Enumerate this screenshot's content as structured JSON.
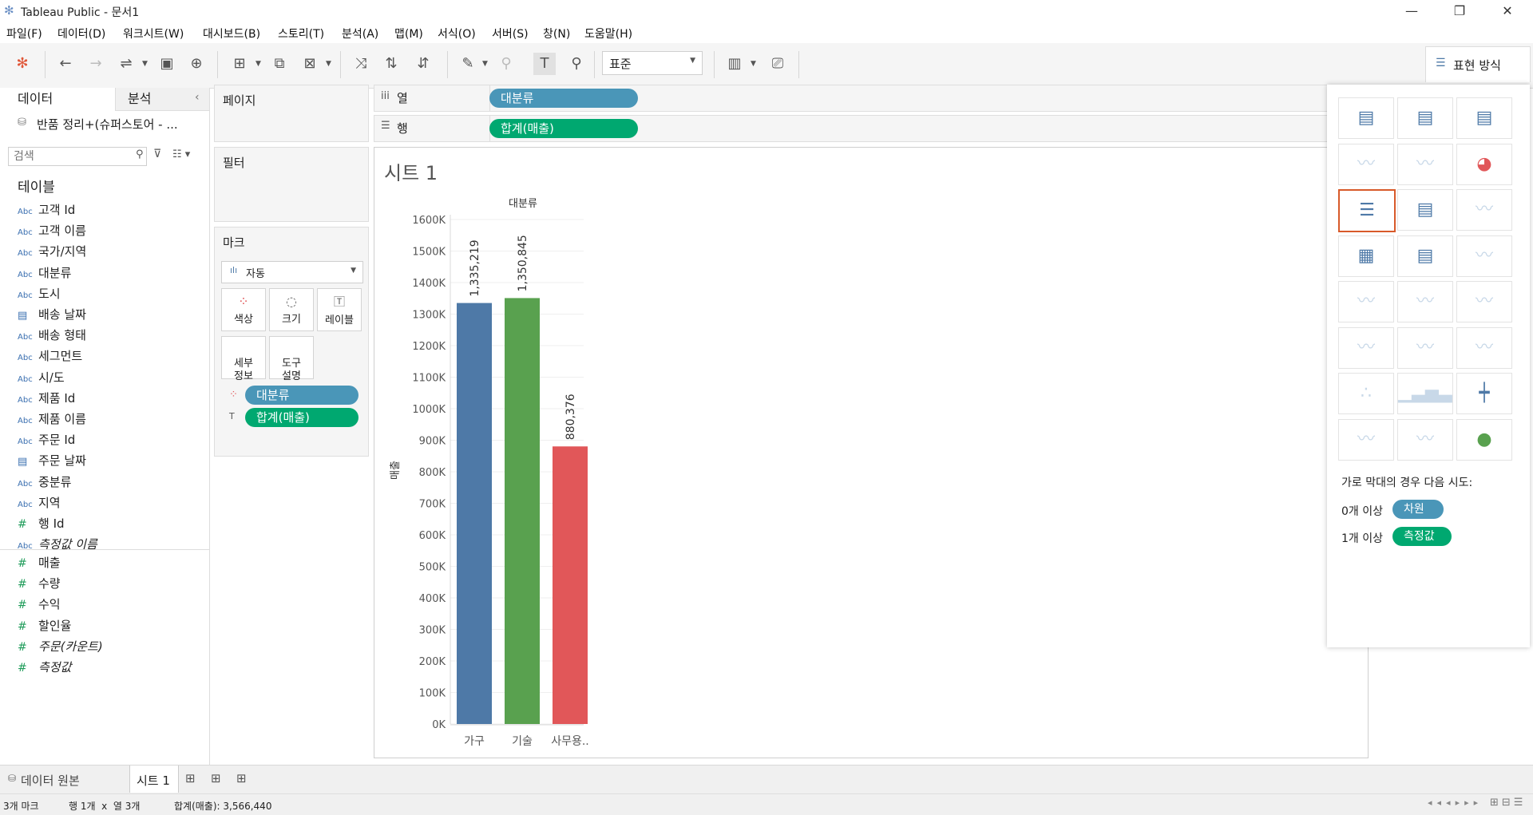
{
  "window": {
    "title": "Tableau Public - 문서1"
  },
  "menu": [
    "파일(F)",
    "데이터(D)",
    "워크시트(W)",
    "대시보드(B)",
    "스토리(T)",
    "분석(A)",
    "맵(M)",
    "서식(O)",
    "서버(S)",
    "창(N)",
    "도움말(H)"
  ],
  "toolbar": {
    "fit_select": "표준",
    "show_me_label": "표현 방식"
  },
  "data_pane": {
    "tab_data": "데이터",
    "tab_analysis": "분석",
    "datasource": "반품 정리+(슈퍼스토어 - ...",
    "search_placeholder": "검색",
    "tables_heading": "테이블",
    "dimensions": [
      {
        "type": "Abc",
        "name": "고객 Id"
      },
      {
        "type": "Abc",
        "name": "고객 이름"
      },
      {
        "type": "Abc",
        "name": "국가/지역"
      },
      {
        "type": "Abc",
        "name": "대분류"
      },
      {
        "type": "Abc",
        "name": "도시"
      },
      {
        "type": "date",
        "name": "배송 날짜"
      },
      {
        "type": "Abc",
        "name": "배송 형태"
      },
      {
        "type": "Abc",
        "name": "세그먼트"
      },
      {
        "type": "Abc",
        "name": "시/도"
      },
      {
        "type": "Abc",
        "name": "제품 Id"
      },
      {
        "type": "Abc",
        "name": "제품 이름"
      },
      {
        "type": "Abc",
        "name": "주문 Id"
      },
      {
        "type": "date",
        "name": "주문 날짜"
      },
      {
        "type": "Abc",
        "name": "중분류"
      },
      {
        "type": "Abc",
        "name": "지역"
      },
      {
        "type": "#",
        "name": "행 Id"
      },
      {
        "type": "Abc",
        "name": "측정값 이름",
        "italic": true
      }
    ],
    "measures": [
      {
        "name": "매출"
      },
      {
        "name": "수량"
      },
      {
        "name": "수익"
      },
      {
        "name": "할인율"
      },
      {
        "name": "주문(카운트)",
        "italic": true
      },
      {
        "name": "측정값",
        "italic": true
      }
    ]
  },
  "cards": {
    "pages": "페이지",
    "filters": "필터",
    "marks": "마크",
    "mark_type": "자동",
    "mark_buttons": {
      "color": "색상",
      "size": "크기",
      "label": "레이블",
      "detail": "세부\n정보",
      "tooltip": "도구\n설명"
    },
    "mark_pills": {
      "color_field": "대분류",
      "label_field": "합계(매출)"
    }
  },
  "shelves": {
    "columns_label": "열",
    "columns_pill": "대분류",
    "rows_label": "행",
    "rows_pill": "합계(매출)"
  },
  "sheet_title": "시트 1",
  "chart_data": {
    "type": "bar",
    "title": "대분류",
    "ylabel": "매출",
    "categories": [
      "가구",
      "기술",
      "사무용.."
    ],
    "values": [
      1335219,
      1350845,
      880376
    ],
    "value_labels": [
      "1,335,219",
      "1,350,845",
      "880,376"
    ],
    "colors": [
      "#4e79a7",
      "#59a14f",
      "#e15759"
    ],
    "ylim": [
      0,
      1600000
    ],
    "ytick_labels": [
      "0K",
      "100K",
      "200K",
      "300K",
      "400K",
      "500K",
      "600K",
      "700K",
      "800K",
      "900K",
      "1000K",
      "1100K",
      "1200K",
      "1300K",
      "1400K",
      "1500K",
      "1600K"
    ],
    "grid": true
  },
  "show_me": {
    "hint": "가로 막대의 경우 다음 시도:",
    "dim_req": "0개 이상",
    "dim_pill": "차원",
    "meas_req": "1개 이상",
    "meas_pill": "측정값"
  },
  "bottom_tabs": {
    "datasource": "데이터 원본",
    "sheet": "시트 1"
  },
  "status": {
    "marks": "3개 마크",
    "rows_cols": "행 1개  x  열 3개",
    "sum": "합계(매출): 3,566,440"
  }
}
